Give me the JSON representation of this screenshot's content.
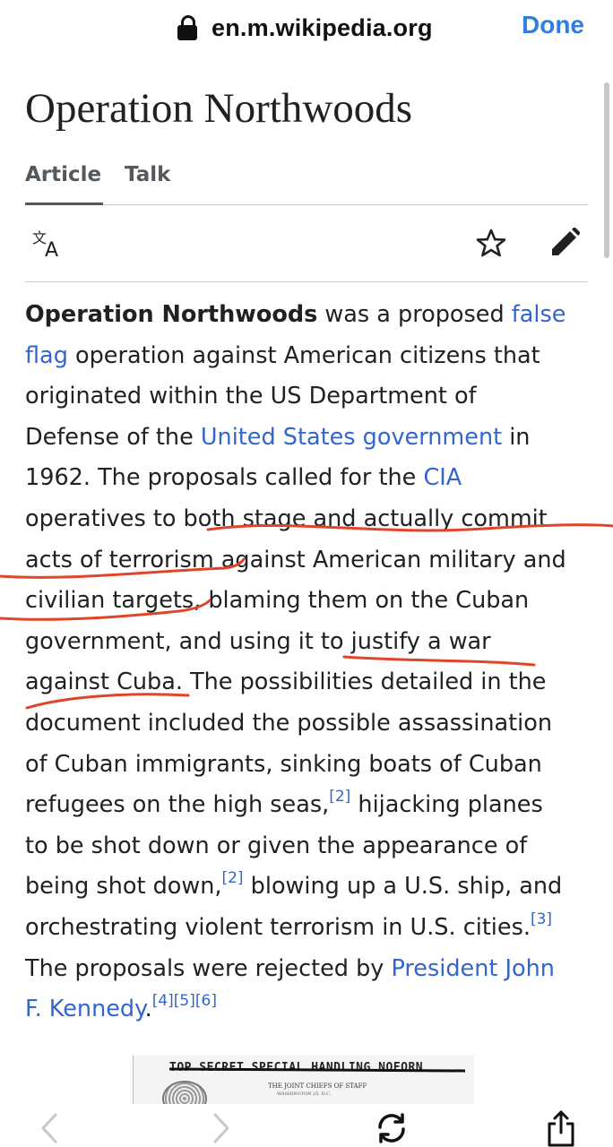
{
  "browser": {
    "url": "en.m.wikipedia.org",
    "done_label": "Done"
  },
  "page": {
    "title": "Operation Northwoods",
    "tabs": [
      {
        "label": "Article",
        "active": true
      },
      {
        "label": "Talk",
        "active": false
      }
    ],
    "tools": {
      "language_icon": "translate-icon",
      "watch_icon": "star-icon",
      "edit_icon": "pencil-icon"
    }
  },
  "article": {
    "lines": [
      {
        "s": [
          [
            "b",
            "Operation Northwoods"
          ],
          [
            "t",
            " was a proposed "
          ],
          [
            "a",
            "false"
          ]
        ]
      },
      {
        "s": [
          [
            "a",
            "flag"
          ],
          [
            "t",
            " operation against American citizens that"
          ]
        ]
      },
      {
        "s": [
          [
            "t",
            "originated within the US Department of"
          ]
        ]
      },
      {
        "s": [
          [
            "t",
            "Defense of the "
          ],
          [
            "a",
            "United States government"
          ],
          [
            "t",
            " in"
          ]
        ]
      },
      {
        "s": [
          [
            "t",
            "1962. The proposals called for the "
          ],
          [
            "a",
            "CIA"
          ]
        ]
      },
      {
        "s": [
          [
            "t",
            "operatives to both stage and actually commit"
          ]
        ]
      },
      {
        "s": [
          [
            "t",
            "acts of terrorism against American military and"
          ]
        ]
      },
      {
        "s": [
          [
            "t",
            "civilian targets, blaming them on the Cuban"
          ]
        ]
      },
      {
        "s": [
          [
            "t",
            "government, and using it to justify a war"
          ]
        ]
      },
      {
        "s": [
          [
            "t",
            "against Cuba. The possibilities detailed in the"
          ]
        ]
      },
      {
        "s": [
          [
            "t",
            "document included the possible assassination"
          ]
        ]
      },
      {
        "s": [
          [
            "t",
            "of Cuban immigrants, sinking boats of Cuban"
          ]
        ]
      },
      {
        "s": [
          [
            "t",
            "refugees on the high seas,"
          ],
          [
            "sup",
            "[2]"
          ],
          [
            "t",
            " hijacking planes"
          ]
        ]
      },
      {
        "s": [
          [
            "t",
            "to be shot down or given the appearance of"
          ]
        ]
      },
      {
        "s": [
          [
            "t",
            "being shot down,"
          ],
          [
            "sup",
            "[2]"
          ],
          [
            "t",
            " blowing up a U.S. ship, and"
          ]
        ]
      },
      {
        "s": [
          [
            "t",
            "orchestrating violent terrorism in U.S. cities."
          ],
          [
            "sup",
            "[3]"
          ]
        ]
      },
      {
        "s": [
          [
            "t",
            "The proposals were rejected by "
          ],
          [
            "a",
            "President John"
          ]
        ]
      },
      {
        "s": [
          [
            "a",
            "F. Kennedy"
          ],
          [
            "t",
            "."
          ],
          [
            "sup",
            "[4]"
          ],
          [
            "sup",
            "[5]"
          ],
          [
            "sup",
            "[6]"
          ]
        ]
      }
    ],
    "link_color": "#3366cc",
    "annotation_color": "#e0452a"
  },
  "document_image": {
    "header_text": "TOP SECRET SPECIAL HANDLING NOFORN",
    "sub_text": "THE JOINT CHIEFS OF STAFF",
    "sub_text2": "WASHINGTON 25, D.C."
  },
  "toolbar": {
    "back_icon": "chevron-left-icon",
    "forward_icon": "chevron-right-icon",
    "reload_icon": "reload-icon",
    "share_icon": "share-icon"
  }
}
